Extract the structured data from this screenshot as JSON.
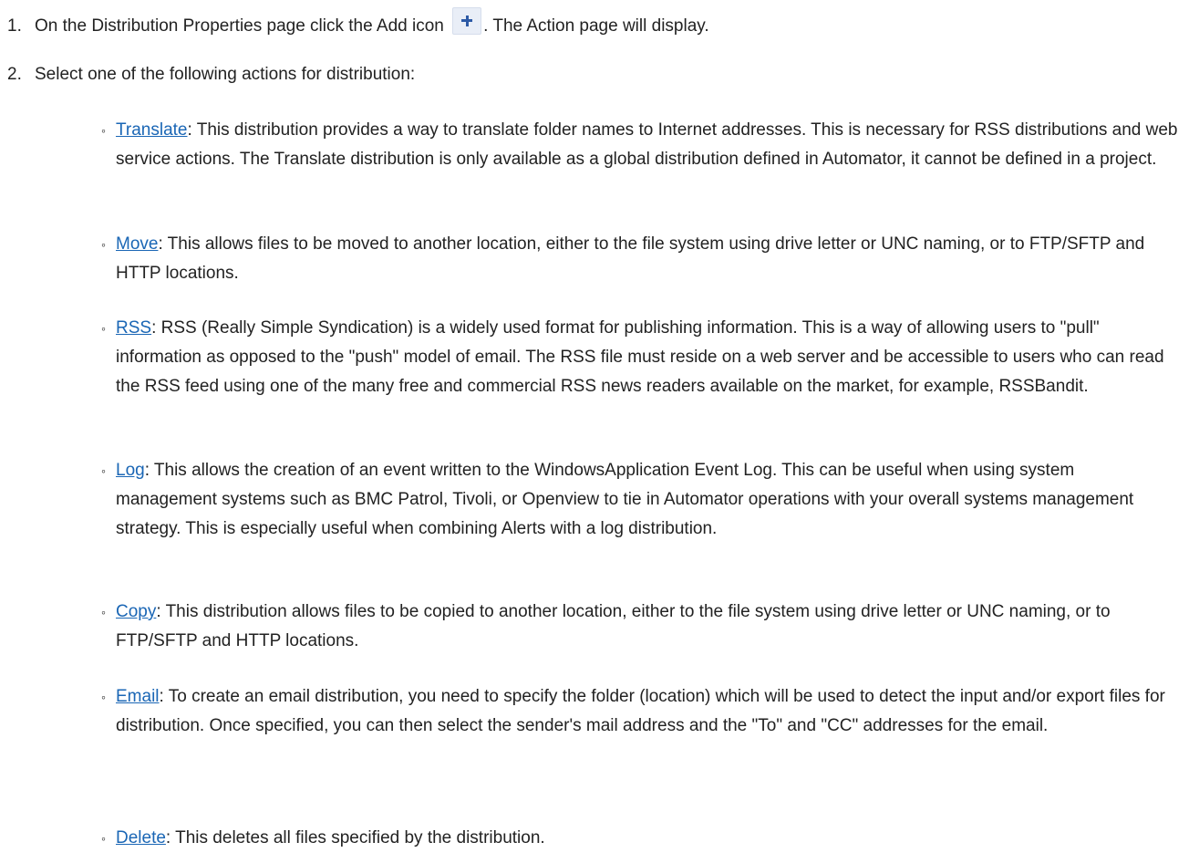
{
  "steps": [
    {
      "number": "1.",
      "text_before_icon": "On the Distribution Properties page click the Add icon",
      "icon": "add-plus-icon",
      "text_after_icon": ". The Action page will display."
    },
    {
      "number": "2.",
      "text": "Select one of the following actions for distribution:"
    }
  ],
  "actions": [
    {
      "link": "Translate",
      "description": ": This distribution provides a way to translate folder names to Internet addresses. This is necessary for RSS distributions and web service actions. The Translate distribution is only available as a global distribution defined in Automator, it cannot be defined in a project."
    },
    {
      "link": "Move",
      "description": ": This allows files to be moved to another location, either to the file system using drive letter or UNC naming, or to FTP/SFTP and HTTP locations."
    },
    {
      "link": "RSS",
      "description": ": RSS (Really Simple Syndication) is a widely used format for publishing information. This is a way of allowing users to \"pull\" information as opposed to the \"push\" model of email. The RSS file must reside on a web server and be accessible to users who can read the RSS feed using one of the many free and commercial RSS news readers available on the market, for example, RSSBandit."
    },
    {
      "link": "Log",
      "description": ": This allows the creation of an event written to the WindowsApplication Event Log. This can be useful when using system management systems such as BMC Patrol, Tivoli, or Openview to tie in Automator operations with your overall systems management strategy. This is especially useful when combining Alerts with a log distribution."
    },
    {
      "link": "Copy",
      "description": ": This distribution allows files to be copied to another location, either to the file system using drive letter or UNC naming, or to FTP/SFTP and HTTP locations."
    },
    {
      "link": "Email",
      "description": ": To create an email distribution, you need to specify the folder (location) which will be used to detect the input and/or export files for distribution. Once specified, you can then select the sender's mail address and the \"To\" and \"CC\" addresses for the email."
    },
    {
      "link": "Delete",
      "description": ": This deletes all files specified by the distribution."
    }
  ],
  "colors": {
    "link": "#1a66b5",
    "text": "#222222",
    "icon_fill": "#2d5aa6",
    "icon_bg": "#e9eef7"
  }
}
